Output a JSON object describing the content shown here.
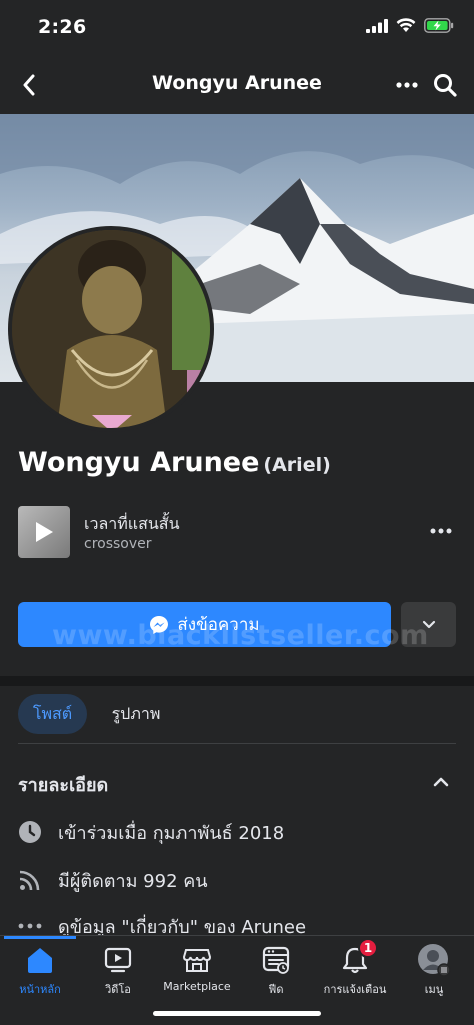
{
  "status_bar": {
    "time": "2:26"
  },
  "nav": {
    "title": "Wongyu Arunee"
  },
  "profile": {
    "name": "Wongyu Arunee",
    "alternate_name": "(Ariel)"
  },
  "music": {
    "title": "เวลาที่แสนสั้น",
    "artist": "crossover"
  },
  "actions": {
    "message_label": "ส่งข้อความ"
  },
  "watermark": "www.blacklistseller.com",
  "tabs": [
    {
      "label": "โพสต์",
      "active": true
    },
    {
      "label": "รูปภาพ",
      "active": false
    }
  ],
  "details": {
    "title": "รายละเอียด",
    "items": [
      {
        "icon": "clock-icon",
        "text": "เข้าร่วมเมื่อ กุมภาพันธ์ 2018"
      },
      {
        "icon": "rss-icon",
        "text": "มีผู้ติดตาม 992 คน"
      },
      {
        "icon": "more-dots-icon",
        "text": "ดูข้อมูล \"เกี่ยวกับ\" ของ Arunee"
      }
    ]
  },
  "bottom_nav": {
    "items": [
      {
        "label": "หน้าหลัก",
        "icon": "home-icon",
        "active": true
      },
      {
        "label": "วิดีโอ",
        "icon": "video-icon",
        "active": false
      },
      {
        "label": "Marketplace",
        "icon": "marketplace-icon",
        "active": false
      },
      {
        "label": "ฟีด",
        "icon": "feed-icon",
        "active": false
      },
      {
        "label": "การแจ้งเตือน",
        "icon": "bell-icon",
        "active": false,
        "badge": "1"
      },
      {
        "label": "เมนู",
        "icon": "avatar-menu-icon",
        "active": false
      }
    ]
  },
  "colors": {
    "accent": "#2d88ff",
    "background": "#242526",
    "badge": "#e41e3f"
  }
}
